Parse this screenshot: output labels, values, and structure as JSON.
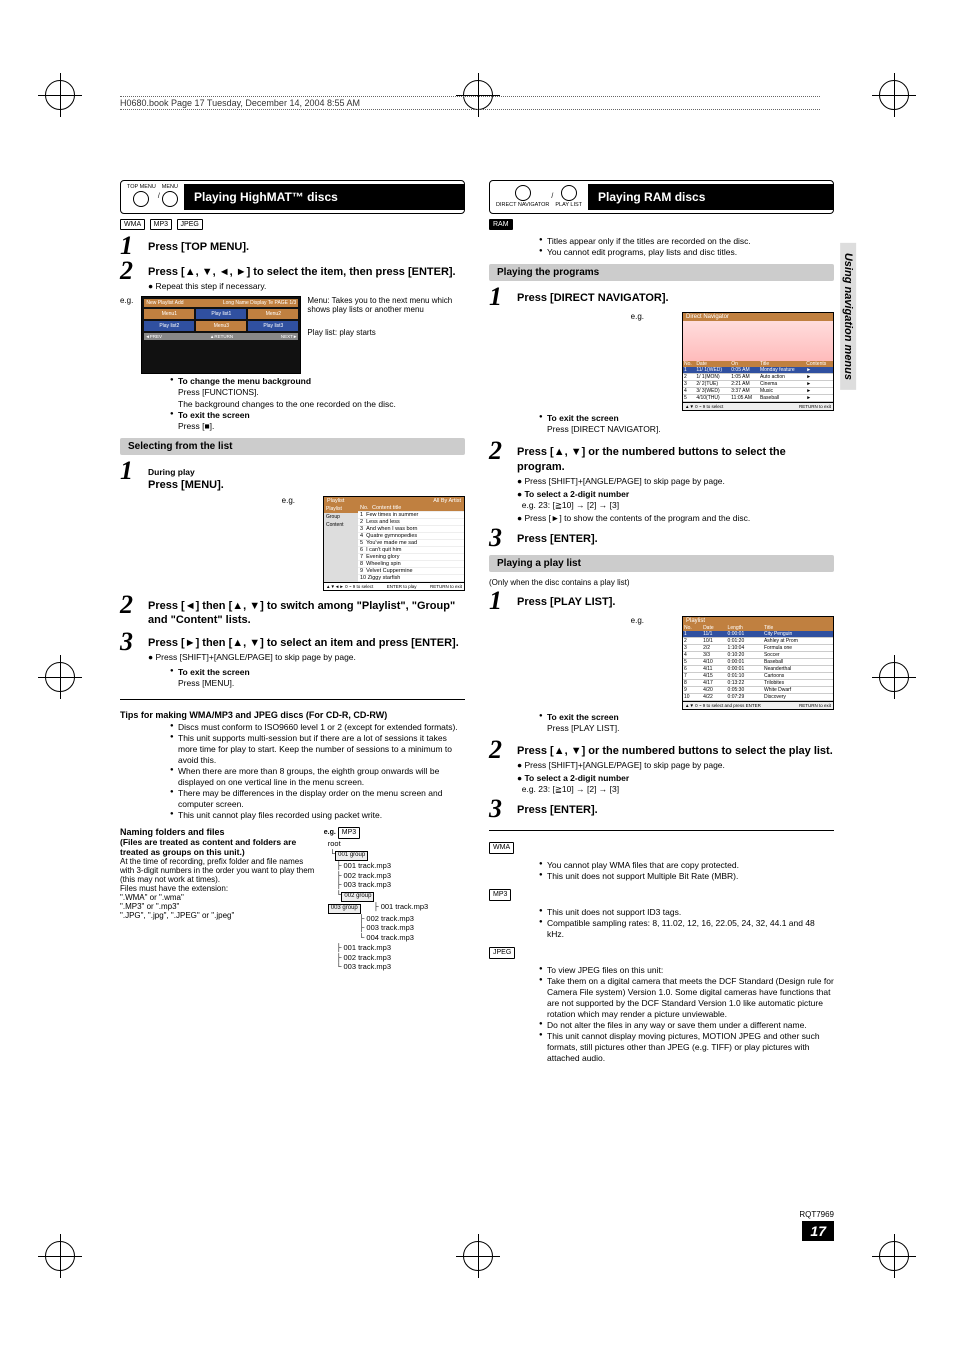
{
  "file_tag": "H0680.book  Page 17  Tuesday, December 14, 2004  8:55 AM",
  "sidebar_label": "Using navigation menus",
  "page_code": "RQT7969",
  "page_num": "17",
  "left": {
    "feature": {
      "icon_top": "TOP MENU",
      "icon_sep": "/",
      "icon_menu": "MENU",
      "title": "Playing HighMAT™ discs"
    },
    "badges": [
      "WMA",
      "MP3",
      "JPEG"
    ],
    "step1": "Press [TOP MENU].",
    "step2": "Press [▲, ▼, ◄, ►] to select the item, then press [ENTER].",
    "step2_note": "Repeat this step if necessary.",
    "eg": "e.g.",
    "menu_desc1": "Menu: Takes you to the next menu which shows play lists or another menu",
    "menu_desc2": "Play list: play starts",
    "highmat_screen": {
      "title_left": "New Playlist Add",
      "title_right": "Long Name Display Te   PAGE 1/3",
      "r1": [
        "Menu1",
        "Play list1",
        "Menu2"
      ],
      "r2": [
        "Play list2",
        "Menu3",
        "Play list3"
      ],
      "foot_left": "◄PREV",
      "foot_mid": "▲RETURN",
      "foot_right": "NEXT►"
    },
    "change_bg": "To change the menu background",
    "change_bg_press": "Press [FUNCTIONS].",
    "change_bg_desc": "The background changes to the one recorded on the disc.",
    "exit": "To exit the screen",
    "exit_press": "Press [■].",
    "selecting_bar": "Selecting from the list",
    "sel_step1a": "During play",
    "sel_step1b": "Press [MENU].",
    "playlist_box": {
      "header": "Playlist",
      "header_right": "All By Artist",
      "nav": [
        "Playlist",
        "Group",
        "Content"
      ],
      "col_no": "No.",
      "col_title": "Content title",
      "items": [
        "Few times in summer",
        "Less and less",
        "And when I was born",
        "Quatre gymnopedies",
        "You've made me sad",
        "I can't quit him",
        "Evening glory",
        "Wheeling spin",
        "Velvet Cuppermine",
        "Ziggy starfish"
      ],
      "footer_left": "▲▼◄►   0 ~ 9   to select",
      "footer_mid": "ENTER to play",
      "footer_right": "RETURN to exit"
    },
    "sel_step2": "Press [◄] then [▲, ▼] to switch among \"Playlist\", \"Group\" and \"Content\" lists.",
    "sel_step3": "Press [►] then [▲, ▼] to select an item and press [ENTER].",
    "sel_step3_note": "Press [SHIFT]+[ANGLE/PAGE] to skip page by page.",
    "sel_exit": "To exit the screen",
    "sel_exit_press": "Press [MENU].",
    "tips_title": "Tips for making WMA/MP3 and JPEG discs (For CD-R, CD-RW)",
    "tips": [
      "Discs must conform to ISO9660 level 1 or 2 (except for extended formats).",
      "This unit supports multi-session but if there are a lot of sessions it takes more time for play to start. Keep the number of sessions to a minimum to avoid this.",
      "When there are more than 8 groups, the eighth group onwards will be displayed on one vertical line in the menu screen.",
      "There may be differences in the display order on the menu screen and computer screen.",
      "This unit cannot play files recorded using packet write."
    ],
    "naming_title": "Naming folders and files",
    "naming_sub": "(Files are treated as content and folders are treated as groups on this unit.)",
    "naming_body": "At the time of recording, prefix folder and file names with 3-digit numbers in the order you want to play them (this may not work at times).",
    "naming_ext_intro": "Files must have the extension:",
    "naming_ext": [
      "\".WMA\" or \".wma\"",
      "\".MP3\" or \".mp3\"",
      "\".JPG\", \".jpg\", \".JPEG\" or \".jpeg\""
    ],
    "tree": {
      "eg": "e.g.",
      "fmt": "MP3",
      "root": "root",
      "g1": "001 group",
      "g1_files": [
        "001 track.mp3",
        "002 track.mp3",
        "003 track.mp3"
      ],
      "g2": "002 group",
      "g2_files": [
        "001 track.mp3",
        "002 track.mp3",
        "003 track.mp3",
        "004 track.mp3"
      ],
      "g3": "003 group",
      "g3_files": [
        "001 track.mp3",
        "002 track.mp3",
        "003 track.mp3"
      ]
    }
  },
  "right": {
    "feature": {
      "icon_left": "DIRECT NAVIGATOR",
      "icon_sep": "/",
      "icon_right": "PLAY LIST",
      "title": "Playing RAM discs"
    },
    "ram_badge": "RAM",
    "ram_notes": [
      "Titles appear only if the titles are recorded on the disc.",
      "You cannot edit programs, play lists and disc titles."
    ],
    "programs_bar": "Playing the programs",
    "prog_step1": "Press [DIRECT NAVIGATOR].",
    "nav_thumb": {
      "title": "Direct Navigator",
      "cols": [
        "No.",
        "Date",
        "On",
        "Title",
        "Contents"
      ],
      "rows": [
        [
          "1",
          "11/ 1(WED)",
          "0:05 AM",
          "Monday feature",
          ""
        ],
        [
          "2",
          "1/ 1(MON)",
          "1:05 AM",
          "Auto action",
          ""
        ],
        [
          "3",
          "2/ 2(TUE)",
          "2:21 AM",
          "Cinema",
          ""
        ],
        [
          "4",
          "3/ 3(WED)",
          "3:37 AM",
          "Music",
          ""
        ],
        [
          "5",
          "4/10(THU)",
          "11:05 AM",
          "Baseball",
          ""
        ]
      ],
      "footer_left": "▲▼ 0 ~ 9 to select",
      "footer_right": "RETURN to exit"
    },
    "prog_exit": "To exit the screen",
    "prog_exit_press": "Press [DIRECT NAVIGATOR].",
    "prog_step2": "Press [▲, ▼] or the numbered buttons to select the program.",
    "prog_step2_n1": "Press [SHIFT]+[ANGLE/PAGE] to skip page by page.",
    "prog_step2_n2": "To select a 2-digit number",
    "prog_step2_n2b": "e.g. 23: [≧10] → [2] → [3]",
    "prog_step2_n3": "Press [►] to show the contents of the program and the disc.",
    "prog_step3": "Press [ENTER].",
    "playlist_bar": "Playing a play list",
    "playlist_cond": "(Only when the disc contains a play list)",
    "pl_step1": "Press [PLAY LIST].",
    "pl_thumb": {
      "title": "Playlist",
      "cols": [
        "No.",
        "Date",
        "Length",
        "Title"
      ],
      "rows": [
        [
          "1",
          "11/1",
          "0:00:01",
          "City Penguin"
        ],
        [
          "2",
          "10/1",
          "0:01:20",
          "Ashley at Prom"
        ],
        [
          "3",
          "2/2",
          "1:10:04",
          "Formula one"
        ],
        [
          "4",
          "3/3",
          "0:10:20",
          "Soccer"
        ],
        [
          "5",
          "4/10",
          "0:00:01",
          "Baseball"
        ],
        [
          "6",
          "4/11",
          "0:00:01",
          "Neanderthal"
        ],
        [
          "7",
          "4/15",
          "0:01:10",
          "Cartoons"
        ],
        [
          "8",
          "4/17",
          "0:13:22",
          "Trilobites"
        ],
        [
          "9",
          "4/20",
          "0:05:30",
          "White Dwarf"
        ],
        [
          "10",
          "4/22",
          "0:07:29",
          "Discovery"
        ]
      ],
      "footer_left": "▲▼ 0 ~ 9 to select and press ENTER",
      "footer_right": "RETURN to exit"
    },
    "pl_exit": "To exit the screen",
    "pl_exit_press": "Press [PLAY LIST].",
    "pl_step2": "Press [▲, ▼] or the numbered buttons to select the play list.",
    "pl_step2_n1": "Press [SHIFT]+[ANGLE/PAGE] to skip page by page.",
    "pl_step2_n2": "To select a 2-digit number",
    "pl_step2_n2b": "e.g. 23: [≧10] → [2] → [3]",
    "pl_step3": "Press [ENTER].",
    "wma_badge": "WMA",
    "wma_notes": [
      "You cannot play WMA files that are copy protected.",
      "This unit does not support Multiple Bit Rate (MBR)."
    ],
    "mp3_badge": "MP3",
    "mp3_notes": [
      "This unit does not support ID3 tags.",
      "Compatible sampling rates: 8, 11.02, 12, 16, 22.05, 24, 32, 44.1 and 48 kHz."
    ],
    "jpeg_badge": "JPEG",
    "jpeg_lead": "To view JPEG files on this unit:",
    "jpeg_sub": [
      "Take them on a digital camera that meets the DCF Standard (Design rule for Camera File system) Version 1.0. Some digital cameras have functions that are not supported by the DCF Standard Version 1.0 like automatic picture rotation which may render a picture unviewable.",
      "Do not alter the files in any way or save them under a different name."
    ],
    "jpeg_note": "This unit cannot display moving pictures, MOTION JPEG and other such formats, still pictures other than JPEG (e.g. TIFF) or play pictures with attached audio."
  }
}
